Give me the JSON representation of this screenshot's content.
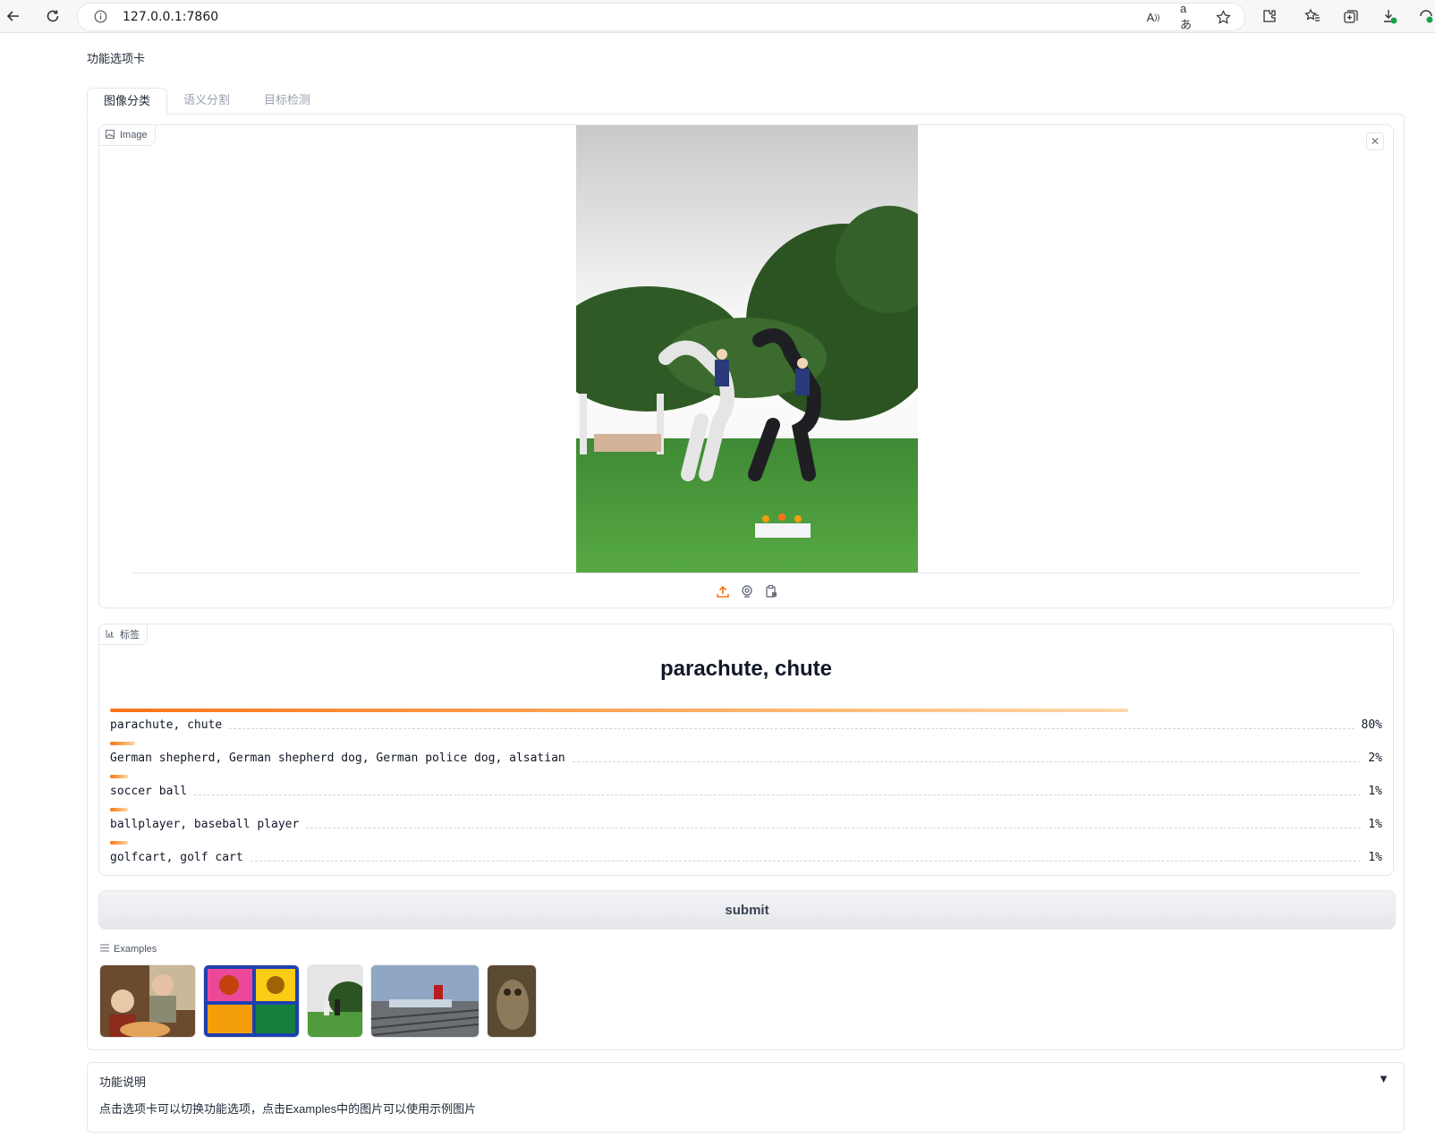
{
  "browser": {
    "url": "127.0.0.1:7860"
  },
  "app": {
    "title": "功能选项卡",
    "tabs": [
      {
        "label": "图像分类",
        "active": true
      },
      {
        "label": "语义分割",
        "active": false
      },
      {
        "label": "目标检测",
        "active": false
      }
    ]
  },
  "image_input": {
    "label": "Image"
  },
  "label_output": {
    "label": "标签",
    "top_label": "parachute, chute",
    "confidences": [
      {
        "name": "parachute, chute",
        "pct": "80%",
        "value": 0.8
      },
      {
        "name": "German shepherd, German shepherd dog, German police dog, alsatian",
        "pct": "2%",
        "value": 0.02
      },
      {
        "name": "soccer ball",
        "pct": "1%",
        "value": 0.01
      },
      {
        "name": "ballplayer, baseball player",
        "pct": "1%",
        "value": 0.01
      },
      {
        "name": "golfcart, golf cart",
        "pct": "1%",
        "value": 0.01
      }
    ]
  },
  "submit_label": "submit",
  "examples": {
    "label": "Examples"
  },
  "accordion": {
    "title": "功能说明",
    "arrow": "▼",
    "body": "点击选项卡可以切换功能选项，点击Examples中的图片可以使用示例图片"
  },
  "colors": {
    "accent": "#f97316",
    "border": "#e5e7eb"
  }
}
